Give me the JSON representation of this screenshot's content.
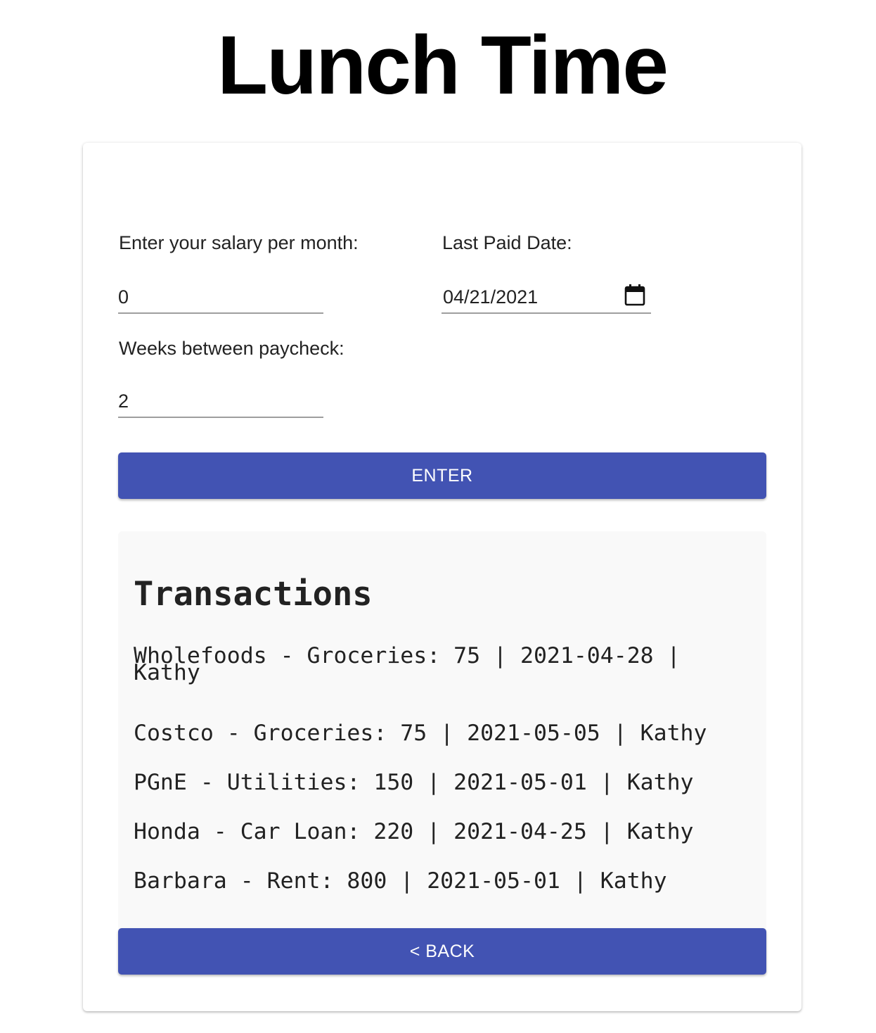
{
  "header": {
    "title": "Lunch Time"
  },
  "form": {
    "salary": {
      "label": "Enter your salary per month:",
      "value": "0"
    },
    "last_paid": {
      "label": "Last Paid Date:",
      "value": "04/21/2021",
      "icon": "calendar-icon"
    },
    "weeks": {
      "label": "Weeks between paycheck:",
      "value": "2"
    },
    "enter_label": "ENTER"
  },
  "transactions": {
    "title": "Transactions",
    "items": [
      "Wholefoods - Groceries: 75 | 2021-04-28 | Kathy",
      "Costco - Groceries: 75 | 2021-05-05 | Kathy",
      "PGnE - Utilities: 150 | 2021-05-01 | Kathy",
      "Honda - Car Loan: 220 | 2021-04-25 | Kathy",
      "Barbara - Rent: 800 | 2021-05-01 | Kathy"
    ]
  },
  "back_label": "< BACK",
  "colors": {
    "primary_button": "#4253b3",
    "panel_background": "#f9f9f9"
  }
}
